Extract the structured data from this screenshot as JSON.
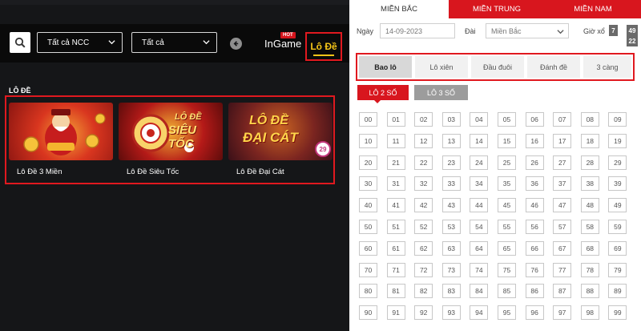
{
  "left": {
    "filters": {
      "provider": "Tất cả NCC",
      "category": "Tất cả"
    },
    "hot_badge": "HOT",
    "tab_ingame": "InGame",
    "tab_lode": "Lô Đề",
    "section_title": "LÔ ĐỀ",
    "games": [
      {
        "name": "Lô Đề 3 Miền"
      },
      {
        "name": "Lô Đề Siêu Tốc",
        "thumb_text_1": "LÔ ĐỀ",
        "thumb_text_2": "SIÊU TỐC"
      },
      {
        "name": "Lô Đề Đại Cát",
        "thumb_text_1": "LÔ ĐỀ",
        "thumb_text_2": "ĐẠI CÁT",
        "badge": "29"
      }
    ]
  },
  "right": {
    "region_tabs": [
      "MIỀN BẮC",
      "MIỀN TRUNG",
      "MIỀN NAM"
    ],
    "form": {
      "date_label": "Ngày",
      "date_value": "14-09-2023",
      "station_label": "Đài",
      "station_value": "Miền Bắc",
      "draw_label": "Giờ xổ",
      "clock": [
        "7",
        "49",
        "22"
      ]
    },
    "bet_types": [
      "Bao lô",
      "Lô xiên",
      "Đầu đuôi",
      "Đánh đề",
      "3 càng"
    ],
    "sub_tabs": [
      "LÔ 2 SỐ",
      "LÔ 3 SỐ"
    ],
    "numbers": [
      "00",
      "01",
      "02",
      "03",
      "04",
      "05",
      "06",
      "07",
      "08",
      "09",
      "10",
      "11",
      "12",
      "13",
      "14",
      "15",
      "16",
      "17",
      "18",
      "19",
      "20",
      "21",
      "22",
      "23",
      "24",
      "25",
      "26",
      "27",
      "28",
      "29",
      "30",
      "31",
      "32",
      "33",
      "34",
      "35",
      "36",
      "37",
      "38",
      "39",
      "40",
      "41",
      "42",
      "43",
      "44",
      "45",
      "46",
      "47",
      "48",
      "49",
      "50",
      "51",
      "52",
      "53",
      "54",
      "55",
      "56",
      "57",
      "58",
      "59",
      "60",
      "61",
      "62",
      "63",
      "64",
      "65",
      "66",
      "67",
      "68",
      "69",
      "70",
      "71",
      "72",
      "73",
      "74",
      "75",
      "76",
      "77",
      "78",
      "79",
      "80",
      "81",
      "82",
      "83",
      "84",
      "85",
      "86",
      "87",
      "88",
      "89",
      "90",
      "91",
      "92",
      "93",
      "94",
      "95",
      "96",
      "97",
      "98",
      "99"
    ],
    "colors": {
      "accent": "#d8161e",
      "gold": "#f5c518"
    }
  }
}
